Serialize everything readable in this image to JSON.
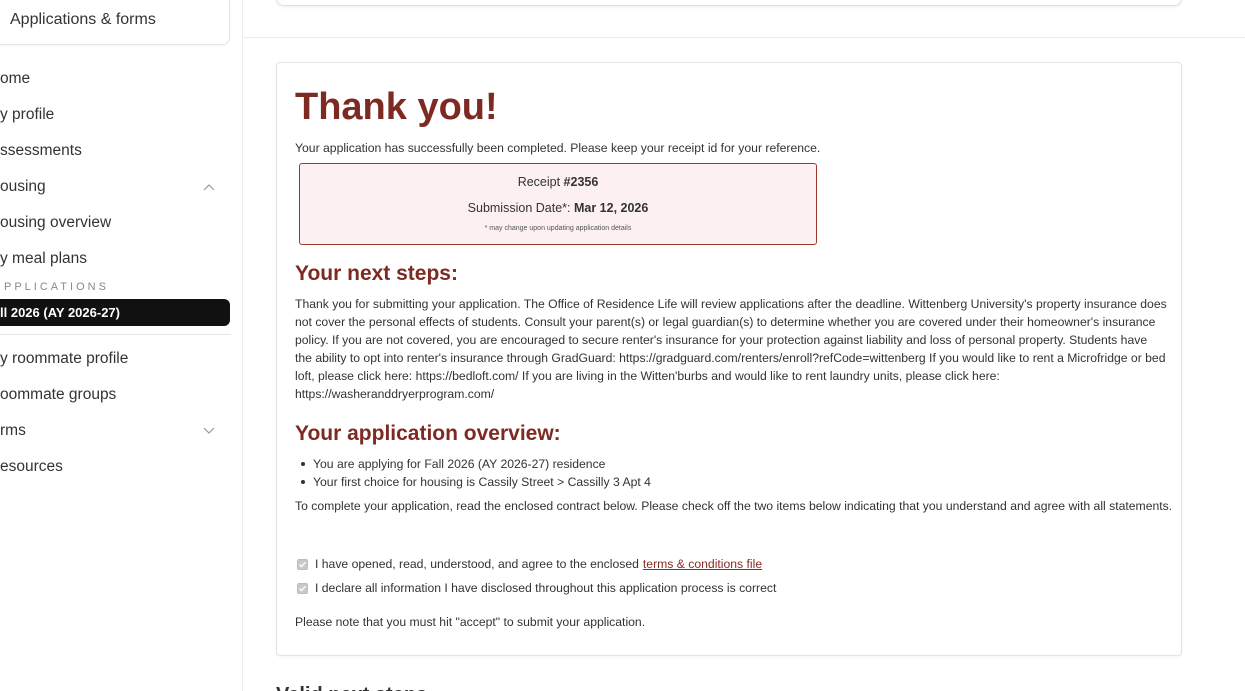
{
  "sidebar": {
    "top_card_label": "Applications & forms",
    "items": [
      {
        "label": "ome"
      },
      {
        "label": "y profile"
      },
      {
        "label": "ssessments"
      },
      {
        "label": "ousing"
      },
      {
        "label": "ousing overview"
      },
      {
        "label": "y meal plans"
      },
      {
        "label": "y roommate profile"
      },
      {
        "label": "oommate groups"
      },
      {
        "label": "rms"
      },
      {
        "label": "esources"
      }
    ],
    "section_label": "PPLICATIONS",
    "active_item": "ll 2026 (AY 2026-27)",
    "housing_chevron_icon": "chevron-up-icon",
    "forms_chevron_icon": "chevron-down-icon"
  },
  "main": {
    "title": "Thank you!",
    "intro": "Your application has successfully been completed. Please keep your receipt id for your reference.",
    "receipt": {
      "label_prefix": "Receipt ",
      "receipt_id": "#2356",
      "date_label": "Submission Date*: ",
      "date_value": "Mar 12, 2026",
      "note": "* may change upon updating application details"
    },
    "next_steps_heading": "Your next steps:",
    "next_steps_text": "Thank you for submitting your application. The Office of Residence Life will review applications after the deadline. Wittenberg University's property insurance does not cover the personal effects of students. Consult your parent(s) or legal guardian(s) to determine whether you are covered under their homeowner's insurance policy. If you are not covered, you are encouraged to secure renter's insurance for your protection against liability and loss of personal property. Students have the ability to opt into renter's insurance through GradGuard: https://gradguard.com/renters/enroll?refCode=wittenberg If you would like to rent a Microfridge or bed loft, please click here: https://bedloft.com/ If you are living in the Witten'burbs and would like to rent laundry units, please click here: https://washeranddryerprogram.com/",
    "overview_heading": "Your application overview:",
    "overview_items": [
      "You are applying for Fall 2026 (AY 2026-27) residence",
      "Your first choice for housing is Cassily Street > Cassilly 3 Apt 4"
    ],
    "complete_text": "To complete your application, read the enclosed contract below. Please check off the two items below indicating that you understand and agree with all statements.",
    "checkbox1_text": "I have opened, read, understood, and agree to the enclosed",
    "checkbox1_link": "terms & conditions file",
    "checkbox2_text": "I declare all information I have disclosed throughout this application process is correct",
    "note": "Please note that you must hit \"accept\" to submit your application.",
    "bottom_peek": "Valid next steps"
  },
  "colors": {
    "accent": "#7d2a22",
    "receipt_border": "#9b3a2e",
    "receipt_bg": "#fdf0f1",
    "active_nav_bg": "#111111"
  }
}
